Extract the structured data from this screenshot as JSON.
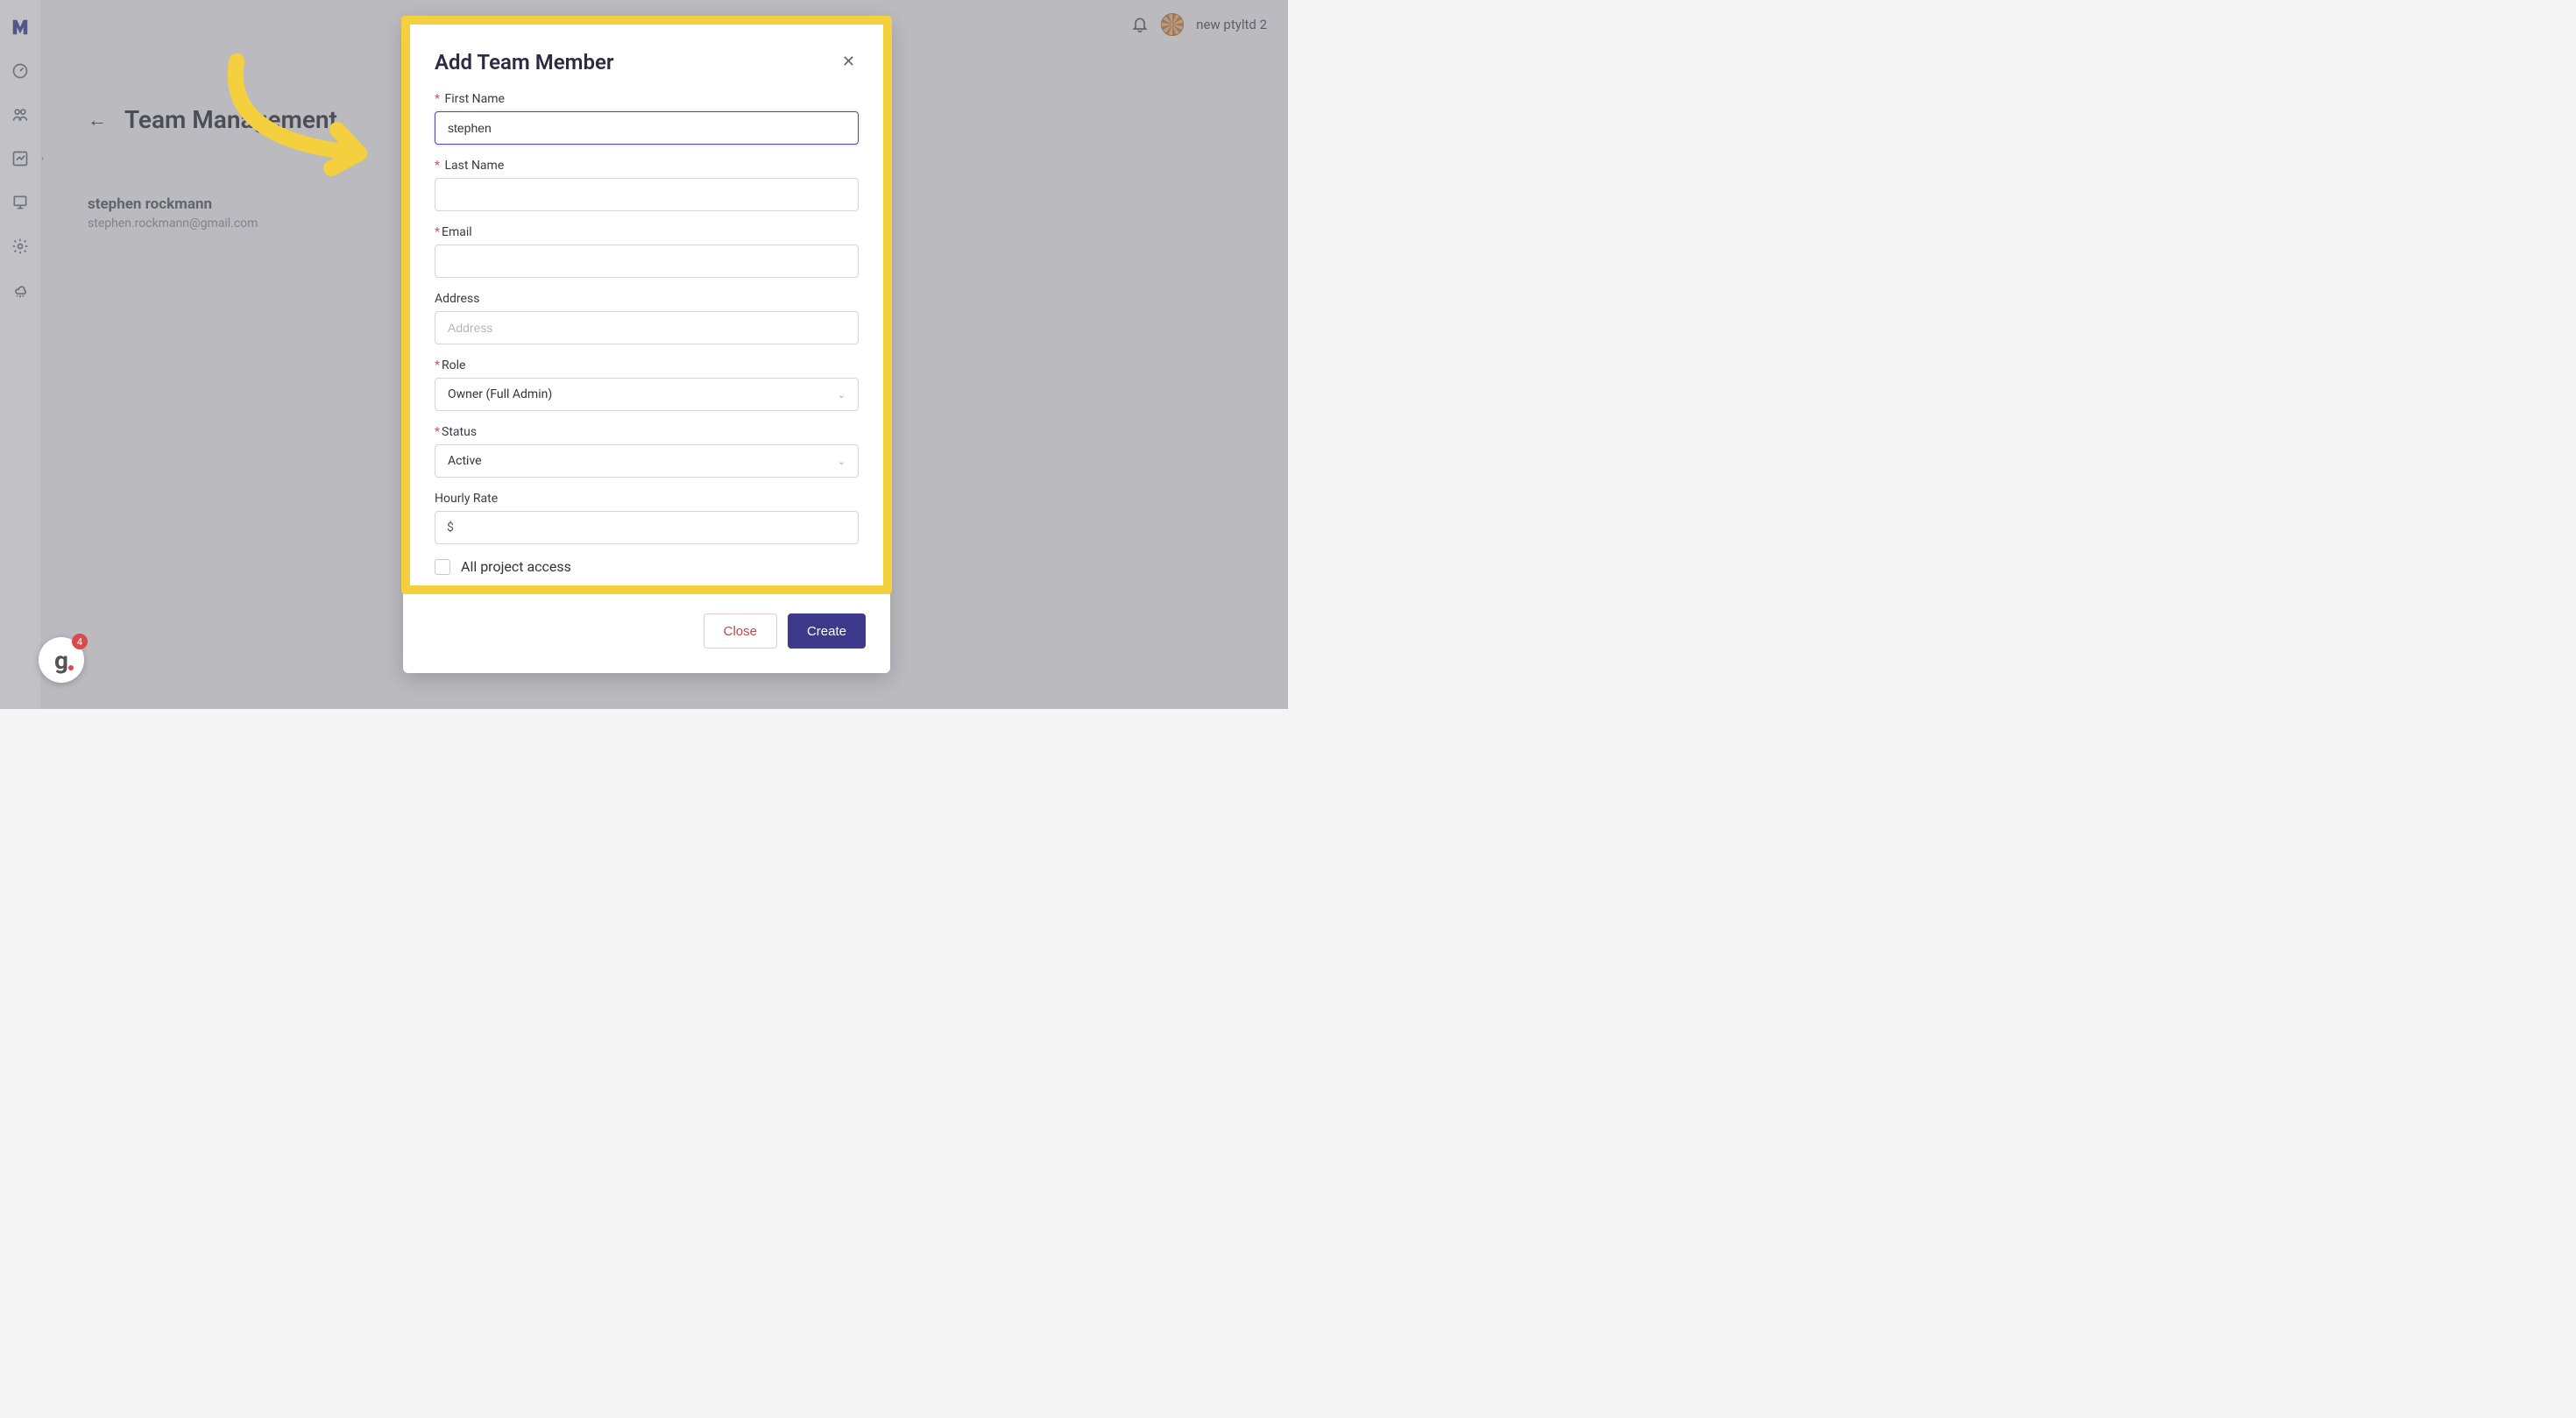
{
  "topbar": {
    "account_name": "new ptyltd 2"
  },
  "page": {
    "title": "Team Management",
    "member": {
      "name": "stephen rockmann",
      "email": "stephen.rockmann@gmail.com"
    }
  },
  "modal": {
    "title": "Add Team Member",
    "fields": {
      "first_name": {
        "label": "First Name",
        "value": "stephen",
        "required": true
      },
      "last_name": {
        "label": "Last Name",
        "value": "",
        "required": true
      },
      "email": {
        "label": "Email",
        "value": "",
        "required": true
      },
      "address": {
        "label": "Address",
        "placeholder": "Address",
        "value": "",
        "required": false
      },
      "role": {
        "label": "Role",
        "value": "Owner (Full Admin)",
        "required": true
      },
      "status": {
        "label": "Status",
        "value": "Active",
        "required": true
      },
      "hourly_rate": {
        "label": "Hourly Rate",
        "prefix": "$",
        "value": "",
        "required": false
      },
      "all_project_access": {
        "label": "All project access",
        "checked": false
      }
    },
    "buttons": {
      "close": "Close",
      "create": "Create"
    }
  },
  "fab": {
    "badge": "4"
  }
}
